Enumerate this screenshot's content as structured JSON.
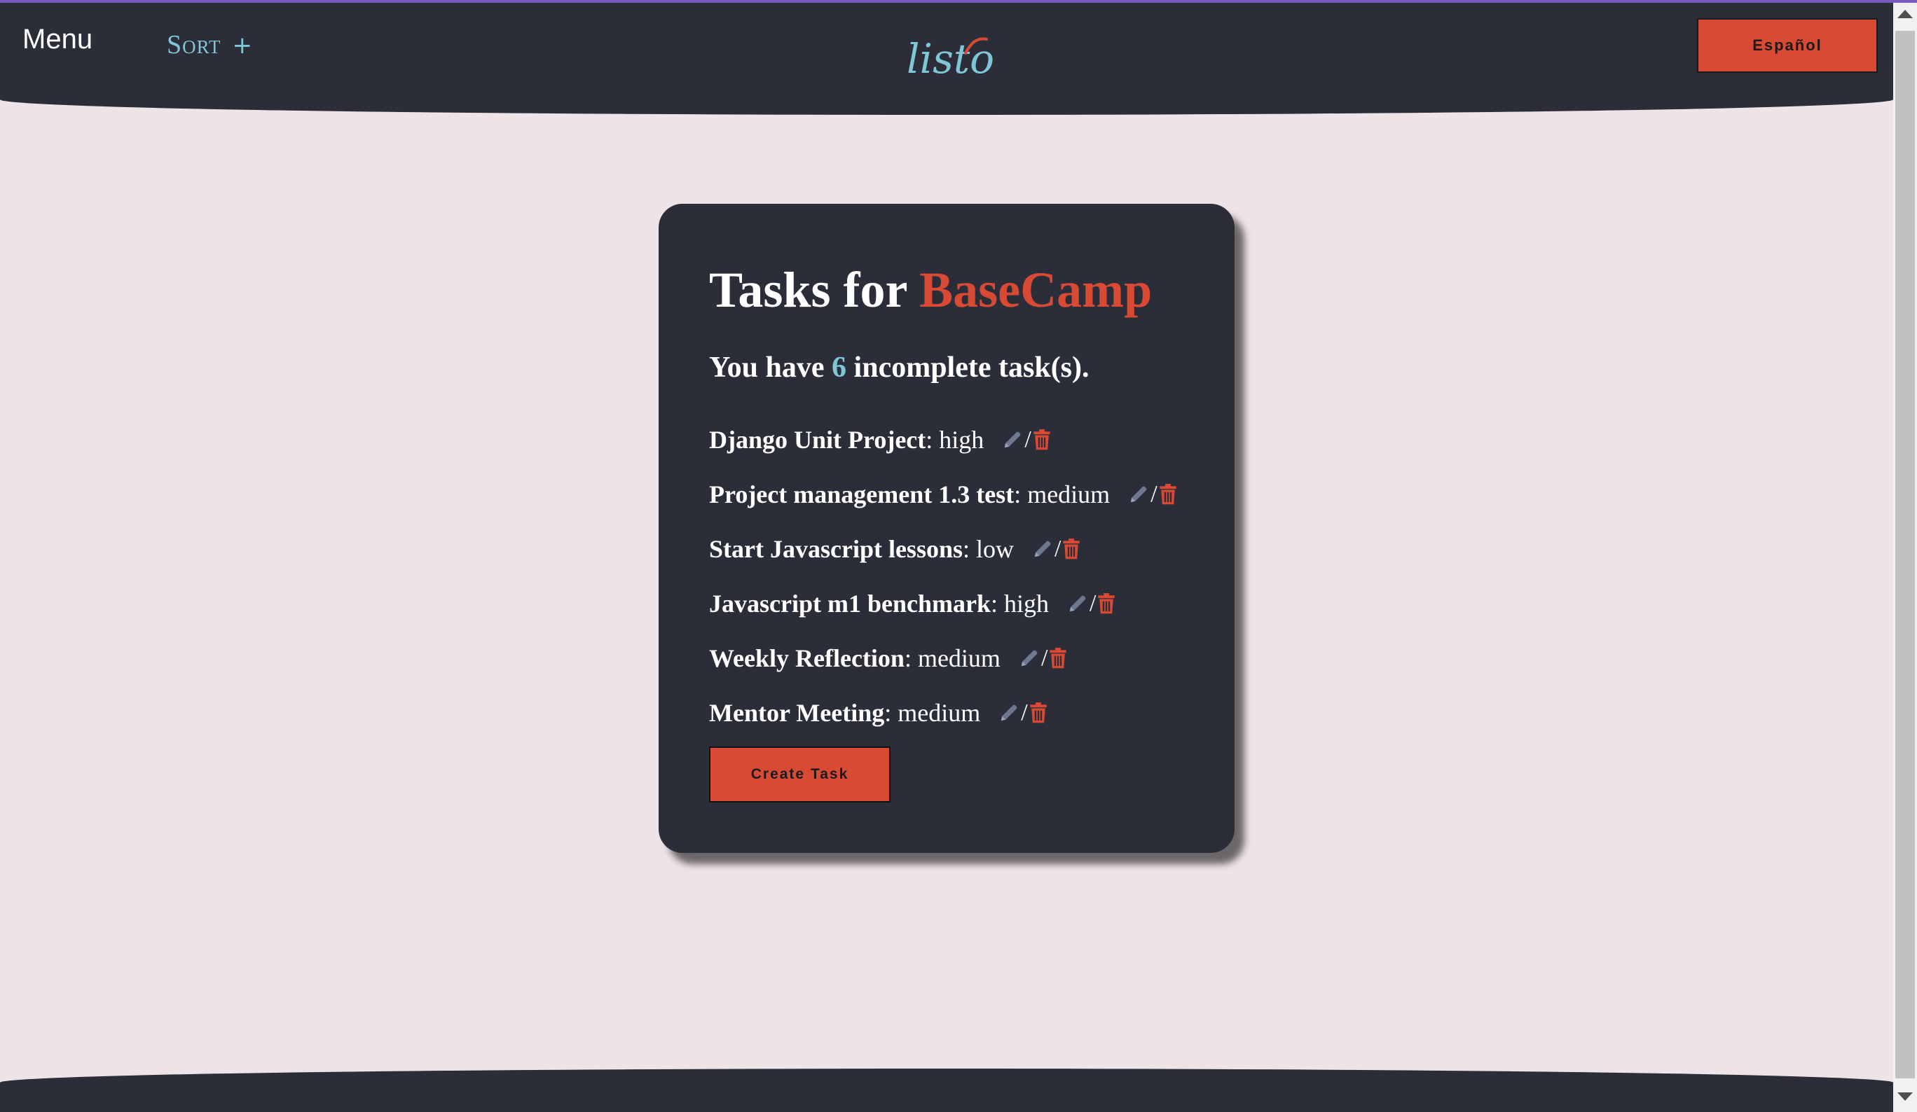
{
  "header": {
    "menu_label": "Menu",
    "sort_label": "Sort",
    "sort_plus": "+",
    "logo_text": "listo",
    "language_button": "Español"
  },
  "card": {
    "title_prefix": "Tasks for",
    "project_name": "BaseCamp",
    "summary_prefix": "You have",
    "incomplete_count": "6",
    "summary_suffix": "incomplete task(s).",
    "tasks": [
      {
        "name": "Django Unit Project",
        "priority": "high"
      },
      {
        "name": "Project management 1.3 test",
        "priority": "medium"
      },
      {
        "name": "Start Javascript lessons",
        "priority": "low"
      },
      {
        "name": "Javascript m1 benchmark",
        "priority": "high"
      },
      {
        "name": "Weekly Reflection",
        "priority": "medium"
      },
      {
        "name": "Mentor Meeting",
        "priority": "medium"
      }
    ],
    "separator": ":",
    "action_separator": "/",
    "create_button": "Create Task"
  },
  "colors": {
    "background": "#eee3e7",
    "header": "#2b2e39",
    "accent_red": "#d84a33",
    "accent_teal": "#7fc6d6",
    "icon_gray": "#6f7890"
  },
  "icons": {
    "edit": "pencil-icon",
    "delete": "trash-icon"
  }
}
